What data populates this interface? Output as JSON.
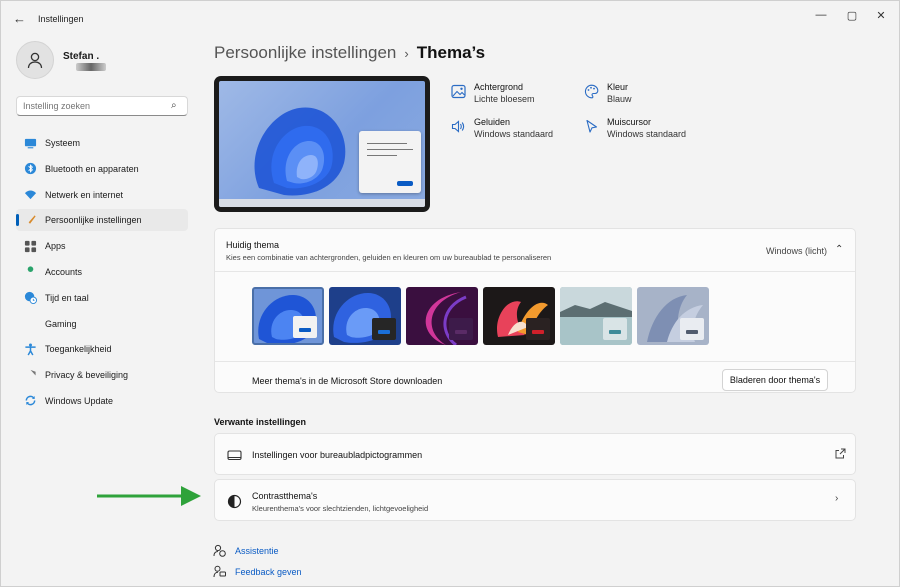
{
  "window": {
    "title": "Instellingen"
  },
  "user": {
    "name": "Stefan ."
  },
  "search": {
    "placeholder": "Instelling zoeken"
  },
  "sidebar": {
    "items": [
      {
        "label": "Systeem",
        "icon": "monitor-icon",
        "color": "#2b88d8"
      },
      {
        "label": "Bluetooth en apparaten",
        "icon": "bluetooth-icon",
        "color": "#2b88d8"
      },
      {
        "label": "Netwerk en internet",
        "icon": "wifi-icon",
        "color": "#2b88d8"
      },
      {
        "label": "Persoonlijke instellingen",
        "icon": "brush-icon",
        "color": "#d88a2b"
      },
      {
        "label": "Apps",
        "icon": "apps-icon",
        "color": "#555"
      },
      {
        "label": "Accounts",
        "icon": "person-icon",
        "color": "#2aa36b"
      },
      {
        "label": "Tijd en taal",
        "icon": "globe-clock-icon",
        "color": "#2b88d8"
      },
      {
        "label": "Gaming",
        "icon": "gamepad-icon",
        "color": "#777"
      },
      {
        "label": "Toegankelijkheid",
        "icon": "accessibility-icon",
        "color": "#2b88d8"
      },
      {
        "label": "Privacy & beveiliging",
        "icon": "shield-icon",
        "color": "#777"
      },
      {
        "label": "Windows Update",
        "icon": "update-icon",
        "color": "#2b88d8"
      }
    ],
    "active_index": 3
  },
  "breadcrumb": {
    "parent": "Persoonlijke instellingen",
    "separator": "›",
    "current": "Thema’s"
  },
  "attributes": {
    "background": {
      "title": "Achtergrond",
      "value": "Lichte bloesem"
    },
    "color": {
      "title": "Kleur",
      "value": "Blauw"
    },
    "sounds": {
      "title": "Geluiden",
      "value": "Windows standaard"
    },
    "cursor": {
      "title": "Muiscursor",
      "value": "Windows standaard"
    }
  },
  "current_theme": {
    "title": "Huidig thema",
    "description": "Kies een combinatie van achtergronden, geluiden en kleuren om uw bureaublad te personaliseren",
    "value": "Windows (licht)",
    "themes": [
      {
        "name": "windows-light",
        "bg": "#6f95d8",
        "mini": "#f2f2f2",
        "accent": "#0a5bc4"
      },
      {
        "name": "windows-dark",
        "bg": "#1e3f8a",
        "mini": "#262626",
        "accent": "#1a6fd8"
      },
      {
        "name": "glow",
        "bg": "#3a0f3f",
        "mini": "#3d1b4a",
        "accent": "#5a2b66"
      },
      {
        "name": "captured-motion",
        "bg": "#1c1818",
        "mini": "#2a2222",
        "accent": "#d0202a"
      },
      {
        "name": "sunrise",
        "bg": "#8fb0b6",
        "mini": "#d9e4e6",
        "accent": "#3f8b99"
      },
      {
        "name": "flow",
        "bg": "#a7b3c8",
        "mini": "#e9ecf1",
        "accent": "#505b6e"
      }
    ],
    "selected_index": 0,
    "store_text": "Meer thema's in de Microsoft Store downloaden",
    "store_button": "Bladeren door thema's"
  },
  "related": {
    "title": "Verwante instellingen",
    "desktop_icons": {
      "title": "Instellingen voor bureaubladpictogrammen"
    },
    "contrast": {
      "title": "Contrastthema's",
      "subtitle": "Kleurenthema's voor slechtzienden, lichtgevoeligheid"
    }
  },
  "help": {
    "assist": "Assistentie",
    "feedback": "Feedback geven"
  },
  "colors": {
    "accent": "#005fb8",
    "annotation_arrow": "#2ea23a"
  }
}
